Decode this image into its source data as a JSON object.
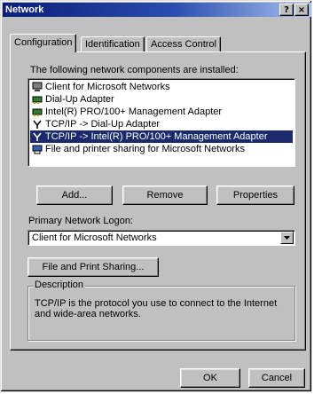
{
  "window": {
    "title": "Network",
    "help_button": "?",
    "close_button": "×"
  },
  "tabs": [
    {
      "label": "Configuration",
      "active": true
    },
    {
      "label": "Identification",
      "active": false
    },
    {
      "label": "Access Control",
      "active": false
    }
  ],
  "components": {
    "heading": "The following network components are installed:",
    "items": [
      {
        "label": "Client for Microsoft Networks",
        "icon": "client-icon",
        "selected": false
      },
      {
        "label": "Dial-Up Adapter",
        "icon": "adapter-icon",
        "selected": false
      },
      {
        "label": "Intel(R) PRO/100+ Management Adapter",
        "icon": "adapter-icon",
        "selected": false
      },
      {
        "label": "TCP/IP -> Dial-Up Adapter",
        "icon": "protocol-icon",
        "selected": false
      },
      {
        "label": "TCP/IP -> Intel(R) PRO/100+ Management Adapter",
        "icon": "protocol-icon",
        "selected": true
      },
      {
        "label": "File and printer sharing for Microsoft Networks",
        "icon": "service-icon",
        "selected": false
      }
    ],
    "selection_color": "#1a2a6a"
  },
  "buttons": {
    "add": "Add...",
    "remove": "Remove",
    "properties": "Properties",
    "file_print_sharing": "File and Print Sharing...",
    "ok": "OK",
    "cancel": "Cancel"
  },
  "logon": {
    "label": "Primary Network Logon:",
    "value": "Client for Microsoft Networks"
  },
  "description": {
    "title": "Description",
    "text": "TCP/IP is the protocol you use to connect to the Internet and wide-area networks."
  },
  "colors": {
    "face": "#c0c0c0",
    "title_start": "#0a1e78",
    "title_end": "#a6c2ee"
  }
}
